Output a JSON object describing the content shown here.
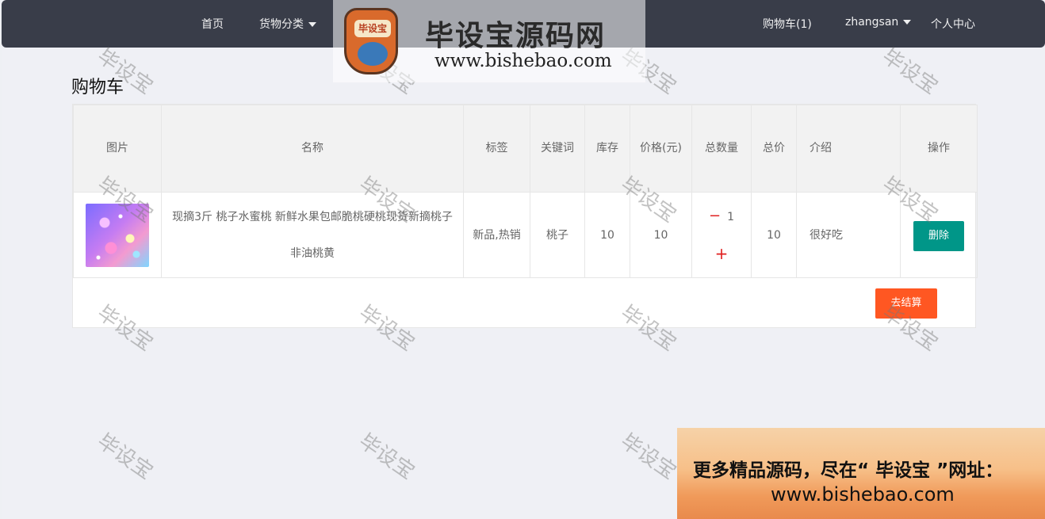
{
  "nav": {
    "home": "首页",
    "category": "货物分类",
    "cart": "购物车(1)",
    "user": "zhangsan",
    "profile": "个人中心"
  },
  "page_title": "购物车",
  "table": {
    "headers": {
      "image": "图片",
      "name": "名称",
      "tag": "标签",
      "keyword": "关键词",
      "stock": "库存",
      "price": "价格(元)",
      "quantity": "总数量",
      "total": "总价",
      "intro": "介绍",
      "action": "操作"
    },
    "rows": [
      {
        "name": "现摘3斤 桃子水蜜桃 新鲜水果包邮脆桃硬桃现货新摘桃子非油桃黄",
        "tag": "新品,热销",
        "keyword": "桃子",
        "stock": "10",
        "price": "10",
        "quantity": "1",
        "minus": "−",
        "plus": "+",
        "total": "10",
        "intro": "很好吃",
        "delete": "删除"
      }
    ]
  },
  "checkout_label": "去结算",
  "watermark": "毕设宝",
  "logo": {
    "badge": "毕设宝",
    "name": "毕设宝源码网",
    "url": "www.bishebao.com"
  },
  "promo": {
    "line1": "更多精品源码，尽在“ 毕设宝 ”网址：",
    "line2": "www.bishebao.com"
  },
  "colors": {
    "nav_bg": "#393d49",
    "delete_btn": "#009688",
    "checkout_btn": "#ff5722",
    "qty_control": "#e02020"
  }
}
